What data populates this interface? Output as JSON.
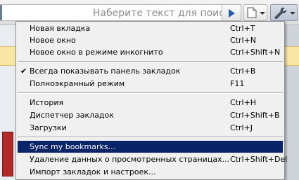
{
  "toolbar": {
    "search_placeholder": "Наберите текст для поиска",
    "icons": [
      "go-arrow-icon",
      "page-icon",
      "wrench-icon"
    ]
  },
  "menu": {
    "items": [
      {
        "label": "Новая вкладка",
        "shortcut": "Ctrl+T",
        "checked": false
      },
      {
        "label": "Новое окно",
        "shortcut": "Ctrl+N",
        "checked": false
      },
      {
        "label": "Новое окно в режиме инкогнито",
        "shortcut": "Ctrl+Shift+N",
        "checked": false
      },
      {
        "label": "Всегда показывать панель закладок",
        "shortcut": "Ctrl+B",
        "checked": true
      },
      {
        "label": "Полноэкранный режим",
        "shortcut": "F11",
        "checked": false
      },
      {
        "label": "История",
        "shortcut": "Ctrl+H",
        "checked": false
      },
      {
        "label": "Диспетчер закладок",
        "shortcut": "Ctrl+Shift+B",
        "checked": false
      },
      {
        "label": "Загрузки",
        "shortcut": "Ctrl+J",
        "checked": false
      },
      {
        "label": "Sync my bookmarks...",
        "shortcut": "",
        "checked": false,
        "highlighted": true
      },
      {
        "label": "Удаление данных о просмотренных страницах...",
        "shortcut": "Ctrl+Shift+Del",
        "checked": false
      },
      {
        "label": "Импорт закладок и настроек...",
        "shortcut": "",
        "checked": false
      }
    ],
    "check_glyph": "✔"
  }
}
